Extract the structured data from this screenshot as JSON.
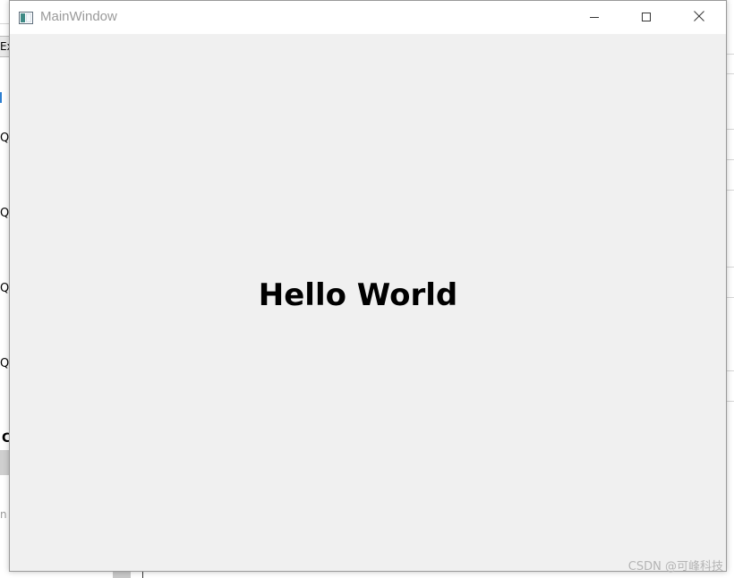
{
  "window": {
    "title": "MainWindow",
    "icon": "app-window-icon",
    "controls": {
      "minimize_icon": "minimize-icon",
      "maximize_icon": "maximize-icon",
      "close_icon": "close-icon"
    }
  },
  "content": {
    "label_text": "Hello World"
  },
  "background_app": {
    "tab_text": "Ex",
    "letters": [
      "Q",
      "Q",
      "Q",
      "Q"
    ],
    "bold_letter": "C",
    "faint_letter": "n"
  },
  "watermark": {
    "text": "CSDN @可峰科技"
  },
  "colors": {
    "client_bg": "#f0f0f0",
    "titlebar_bg": "#ffffff",
    "title_text": "#9a9a9a",
    "label_text": "#000000"
  }
}
